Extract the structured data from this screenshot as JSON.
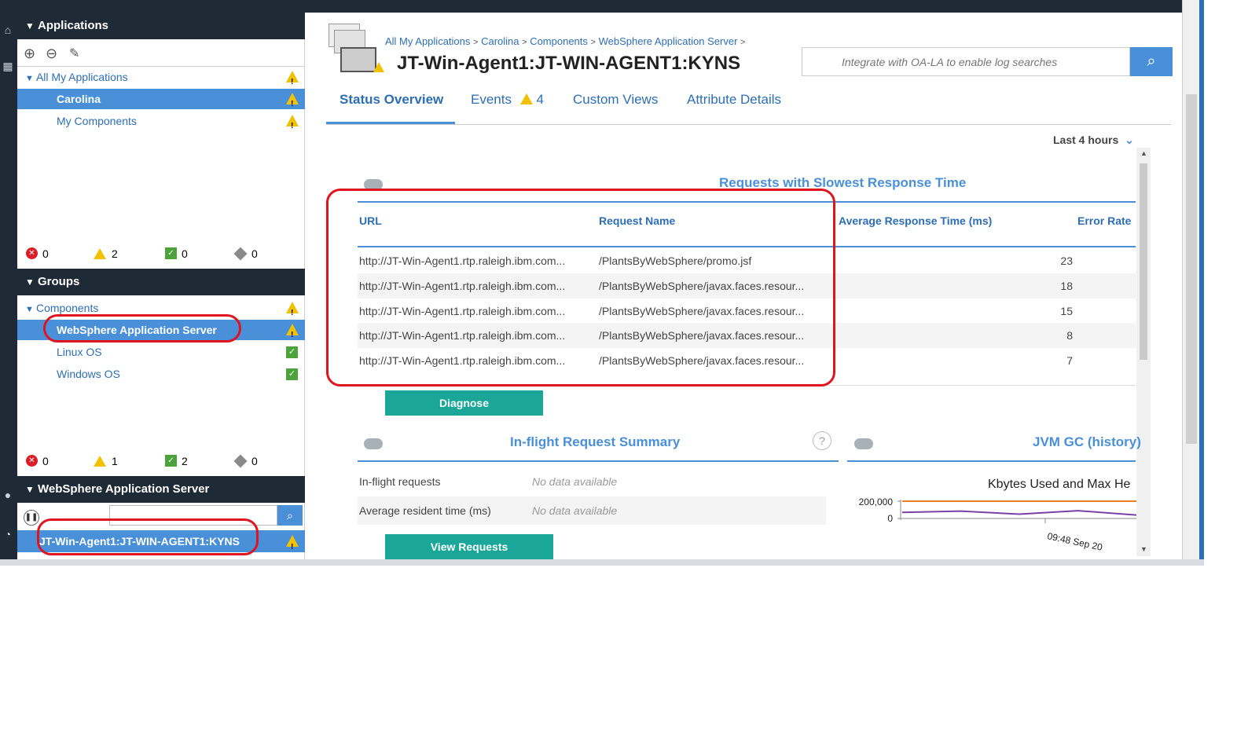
{
  "nav": {
    "applications_header": "Applications",
    "tree_all": "All My Applications",
    "tree_items": [
      "Carolina",
      "My Components"
    ],
    "app_status": {
      "critical": "0",
      "warning": "2",
      "normal": "0",
      "unknown": "0"
    },
    "groups_header": "Groups",
    "components_label": "Components",
    "group_items": [
      "WebSphere Application Server",
      "Linux OS",
      "Windows OS"
    ],
    "group_status": {
      "critical": "0",
      "warning": "1",
      "normal": "2",
      "unknown": "0"
    },
    "was_header": "WebSphere Application Server",
    "instance_item": "JT-Win-Agent1:JT-WIN-AGENT1:KYNS"
  },
  "breadcrumb": [
    "All My Applications",
    "Carolina",
    "Components",
    "WebSphere Application Server"
  ],
  "breadcrumb_sep": ">",
  "page_title": "JT-Win-Agent1:JT-WIN-AGENT1:KYNS",
  "search": {
    "placeholder": "Integrate with OA-LA to enable log searches"
  },
  "tabs": {
    "status": "Status Overview",
    "events": "Events",
    "events_count": "4",
    "custom": "Custom Views",
    "attr": "Attribute Details"
  },
  "time_range": "Last 4 hours",
  "slowest": {
    "title": "Requests with Slowest Response Time",
    "headers": [
      "URL",
      "Request Name",
      "Average Response Time (ms)",
      "Error Rate"
    ],
    "rows": [
      {
        "url": "http://JT-Win-Agent1.rtp.raleigh.ibm.com...",
        "name": "/PlantsByWebSphere/promo.jsf",
        "avg": "23"
      },
      {
        "url": "http://JT-Win-Agent1.rtp.raleigh.ibm.com...",
        "name": "/PlantsByWebSphere/javax.faces.resour...",
        "avg": "18"
      },
      {
        "url": "http://JT-Win-Agent1.rtp.raleigh.ibm.com...",
        "name": "/PlantsByWebSphere/javax.faces.resour...",
        "avg": "15"
      },
      {
        "url": "http://JT-Win-Agent1.rtp.raleigh.ibm.com...",
        "name": "/PlantsByWebSphere/javax.faces.resour...",
        "avg": "8"
      },
      {
        "url": "http://JT-Win-Agent1.rtp.raleigh.ibm.com...",
        "name": "/PlantsByWebSphere/javax.faces.resour...",
        "avg": "7"
      }
    ],
    "button": "Diagnose"
  },
  "inflight": {
    "title": "In-flight Request Summary",
    "help": "?",
    "rows": [
      {
        "label": "In-flight requests",
        "value": "No data available"
      },
      {
        "label": "Average resident time (ms)",
        "value": "No data available"
      }
    ],
    "button": "View Requests"
  },
  "jvm": {
    "title": "JVM GC (history)",
    "chart_title": "Kbytes Used and Max He",
    "ytick_top": "200,000",
    "ytick_zero": "0",
    "xtick": "09:48 Sep 20"
  },
  "chart_data": {
    "type": "line",
    "title": "Kbytes Used and Max He",
    "ylim": [
      0,
      200000
    ],
    "yticks": [
      "200,000",
      "0"
    ],
    "xticks": [
      "09:48 Sep 20"
    ],
    "series": [
      {
        "color": "#e8822a",
        "values": [
          200000,
          200000,
          200000,
          200000,
          200000
        ]
      },
      {
        "color": "#7b3fa8",
        "values": [
          70000,
          85000,
          50000,
          90000,
          40000
        ]
      }
    ]
  },
  "colors": {
    "accent": "#4a90d9",
    "header": "#1e2a35",
    "button": "#1aa79a",
    "highlight": "#e0141e"
  }
}
